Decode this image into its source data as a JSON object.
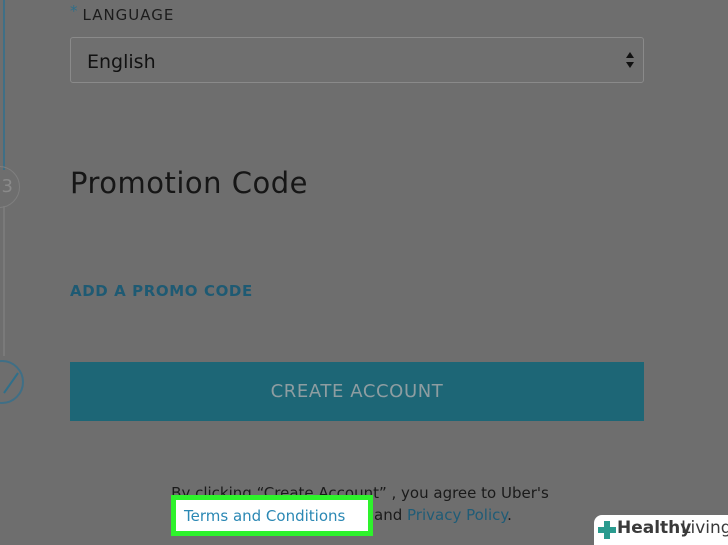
{
  "language": {
    "required_mark": "*",
    "label": "LANGUAGE",
    "selected": "English"
  },
  "rail": {
    "step_number": "3"
  },
  "promotion": {
    "title": "Promotion Code",
    "add_link": "ADD A PROMO CODE"
  },
  "actions": {
    "create_account": "CREATE ACCOUNT"
  },
  "legal": {
    "line1": "By clicking “Create Account” , you agree to Uber's",
    "terms": "Terms and Conditions",
    "and": "and",
    "privacy": "Privacy Policy",
    "period": "."
  },
  "watermark": {
    "brand_bold": "Healthy",
    "brand_light": "Living"
  },
  "colors": {
    "accent": "#1f5c77",
    "highlight": "#2ef22c",
    "button": "#1d6676"
  }
}
